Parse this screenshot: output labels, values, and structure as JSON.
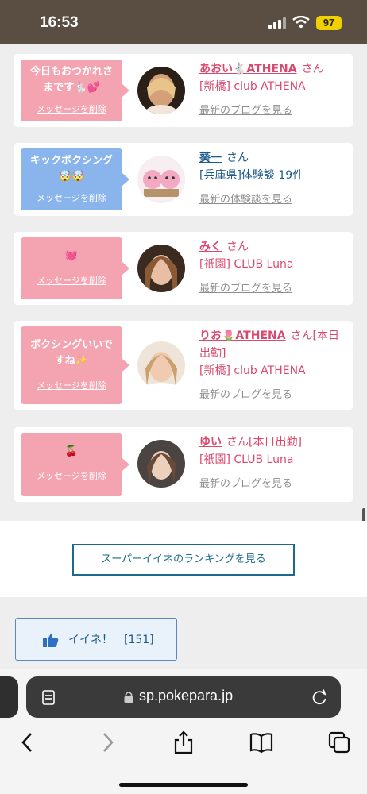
{
  "status": {
    "time": "16:53",
    "battery": "97"
  },
  "messages": [
    {
      "bubble": "今日もおつかれさまです🐇💕",
      "bubble_color": "#f4a3b1",
      "delete": "メッセージを削除",
      "name": "あおい🐇ATHENA",
      "san": "さん",
      "shop": "[新橋] club ATHENA",
      "link": "最新のブログを見る",
      "style": "pink"
    },
    {
      "bubble": "キックボクシング🤯🤯",
      "bubble_color": "#8ab4ec",
      "delete": "メッセージを削除",
      "name": "葵一",
      "san": "さん",
      "shop": "[兵庫県]体験談 19件",
      "link": "最新の体験談を見る",
      "style": "blue"
    },
    {
      "bubble": "💓",
      "bubble_color": "#f4a3b1",
      "delete": "メッセージを削除",
      "name": "みく",
      "san": "さん",
      "shop": "[祇園] CLUB Luna",
      "link": "最新のブログを見る",
      "style": "pink"
    },
    {
      "bubble": "ボクシングいいですね✨",
      "bubble_color": "#f4a3b1",
      "delete": "メッセージを削除",
      "name": "りお🌷ATHENA",
      "san": "さん[本日出勤]",
      "shop": "[新橋] club ATHENA",
      "link": "最新のブログを見る",
      "style": "pink"
    },
    {
      "bubble": "🍒",
      "bubble_color": "#f4a3b1",
      "delete": "メッセージを削除",
      "name": "ゆい",
      "san": "さん[本日出勤]",
      "shop": "[祇園] CLUB Luna",
      "link": "最新のブログを見る",
      "style": "pink"
    }
  ],
  "ranking_button": "スーパーイイネのランキングを見る",
  "like": {
    "label": "イイネ！",
    "count": "[151]"
  },
  "browser": {
    "url": "sp.pokepara.jp"
  },
  "icons": [
    "search-icon",
    "lock-icon",
    "reload-icon",
    "back-icon",
    "forward-icon",
    "share-icon",
    "bookmarks-icon",
    "tabs-icon",
    "thumbs-up-icon"
  ]
}
